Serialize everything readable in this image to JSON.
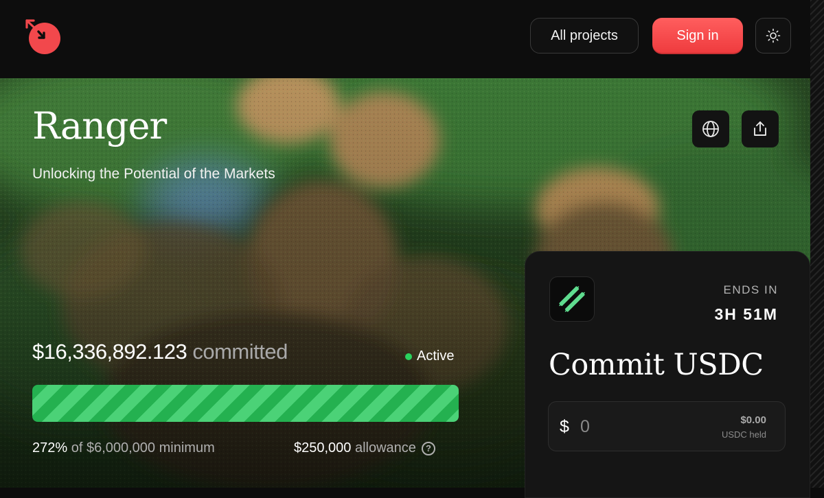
{
  "header": {
    "logo_icon": "mortar-logo-icon",
    "all_projects_label": "All projects",
    "sign_in_label": "Sign in",
    "theme_icon": "sun-icon"
  },
  "project": {
    "name": "Ranger",
    "tagline": "Unlocking the Potential of the Markets",
    "website_icon": "globe-icon",
    "share_icon": "share-icon"
  },
  "raise": {
    "committed_amount": "$16,336,892.123",
    "committed_label": "committed",
    "status": "Active",
    "progress_fraction": 1.0,
    "percent": "272%",
    "of_minimum_text": "of $6,000,000 minimum",
    "allowance_amount": "$250,000",
    "allowance_label": "allowance"
  },
  "commit_panel": {
    "token_icon": "ranger-token-icon",
    "ends_in_label": "ENDS IN",
    "ends_in_value": "3H 51M",
    "title": "Commit USDC",
    "currency_symbol": "$",
    "amount_placeholder": "0",
    "held_value": "$0.00",
    "held_label": "USDC held"
  },
  "colors": {
    "accent_red": "#f24a4d",
    "progress_green": "#2ec15b",
    "status_green": "#2ad35e"
  }
}
